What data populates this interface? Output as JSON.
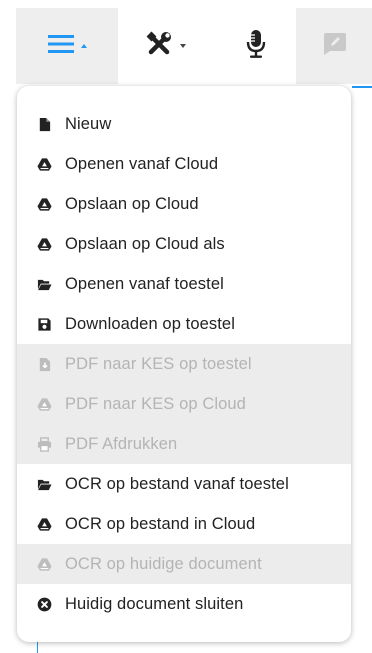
{
  "toolbar": {
    "buttons": [
      {
        "name": "menu-button",
        "icon": "hamburger-icon",
        "state": "active"
      },
      {
        "name": "tools-button",
        "icon": "tools-icon"
      },
      {
        "name": "microphone-button",
        "icon": "microphone-icon"
      },
      {
        "name": "comment-button",
        "icon": "comment-edit-icon",
        "state": "disabled"
      }
    ]
  },
  "menu": {
    "items": [
      {
        "label": "Nieuw",
        "icon": "new-file-icon",
        "enabled": true
      },
      {
        "label": "Openen vanaf Cloud",
        "icon": "cloud-drive-icon",
        "enabled": true
      },
      {
        "label": "Opslaan op Cloud",
        "icon": "cloud-drive-icon",
        "enabled": true
      },
      {
        "label": "Opslaan op Cloud als",
        "icon": "cloud-drive-icon",
        "enabled": true
      },
      {
        "label": "Openen vanaf toestel",
        "icon": "folder-open-icon",
        "enabled": true
      },
      {
        "label": "Downloaden op toestel",
        "icon": "save-icon",
        "enabled": true
      },
      {
        "label": "PDF naar KES op toestel",
        "icon": "file-download-icon",
        "enabled": false
      },
      {
        "label": "PDF naar KES op Cloud",
        "icon": "cloud-drive-icon",
        "enabled": false
      },
      {
        "label": "PDF Afdrukken",
        "icon": "printer-icon",
        "enabled": false
      },
      {
        "label": "OCR op bestand vanaf toestel",
        "icon": "folder-open-icon",
        "enabled": true
      },
      {
        "label": "OCR op bestand in Cloud",
        "icon": "cloud-drive-icon",
        "enabled": true
      },
      {
        "label": "OCR op huidige document",
        "icon": "cloud-drive-icon",
        "enabled": false
      },
      {
        "label": "Huidig document sluiten",
        "icon": "close-circle-icon",
        "enabled": true
      }
    ]
  },
  "colors": {
    "accent": "#2196f3",
    "text": "#222222",
    "disabled_text": "#b4b4b4",
    "disabled_bg": "#ececec"
  }
}
